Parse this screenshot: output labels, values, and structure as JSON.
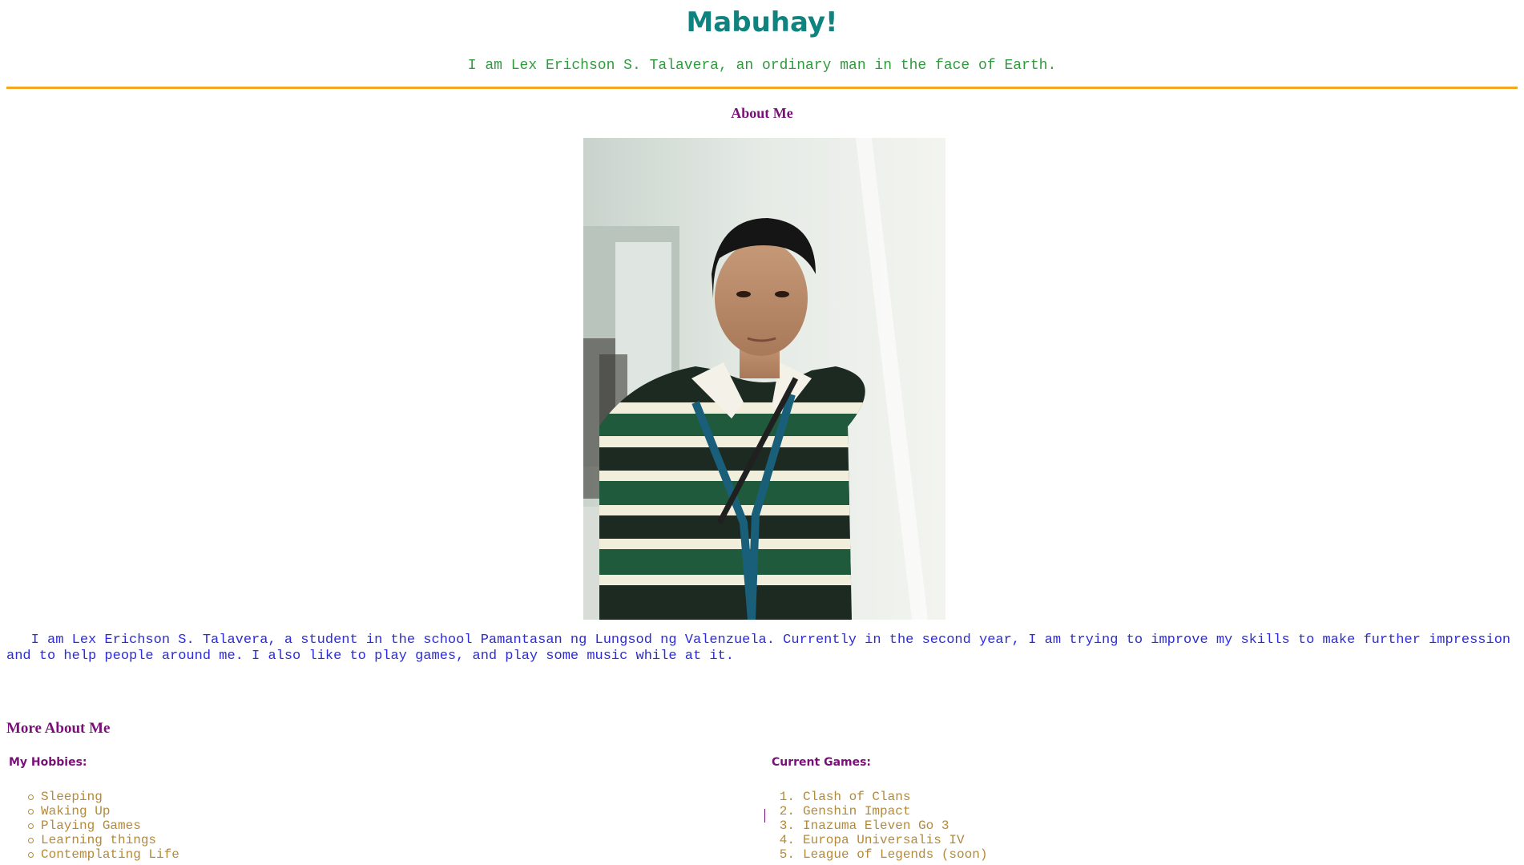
{
  "header": {
    "title": "Mabuhay!",
    "tagline": "I am Lex Erichson S. Talavera, an ordinary man in the face of Earth."
  },
  "about": {
    "heading": "About Me",
    "photo_label": "Portrait photo of Lex Erichson S. Talavera",
    "bio": "I am Lex Erichson S. Talavera, a student in the school Pamantasan ng Lungsod ng Valenzuela. Currently in the second year, I am trying to improve my skills to make further impression and to help people around me. I also like to play games, and play some music while at it."
  },
  "more": {
    "heading": "More About Me",
    "hobbies_heading": "My Hobbies:",
    "hobbies": [
      "Sleeping",
      "Waking Up",
      "Playing Games",
      "Learning things",
      "Contemplating Life"
    ],
    "games_heading": "Current Games:",
    "games": [
      "Clash of Clans",
      "Genshin Impact",
      "Inazuma Eleven Go 3",
      "Europa Universalis IV",
      "League of Legends (soon)"
    ]
  },
  "colors": {
    "title": "#0f837f",
    "tagline": "#2e9b3c",
    "rule": "#f5a623",
    "heading": "#7a0f7a",
    "bio": "#2c2cd8",
    "list": "#b38a3a"
  }
}
